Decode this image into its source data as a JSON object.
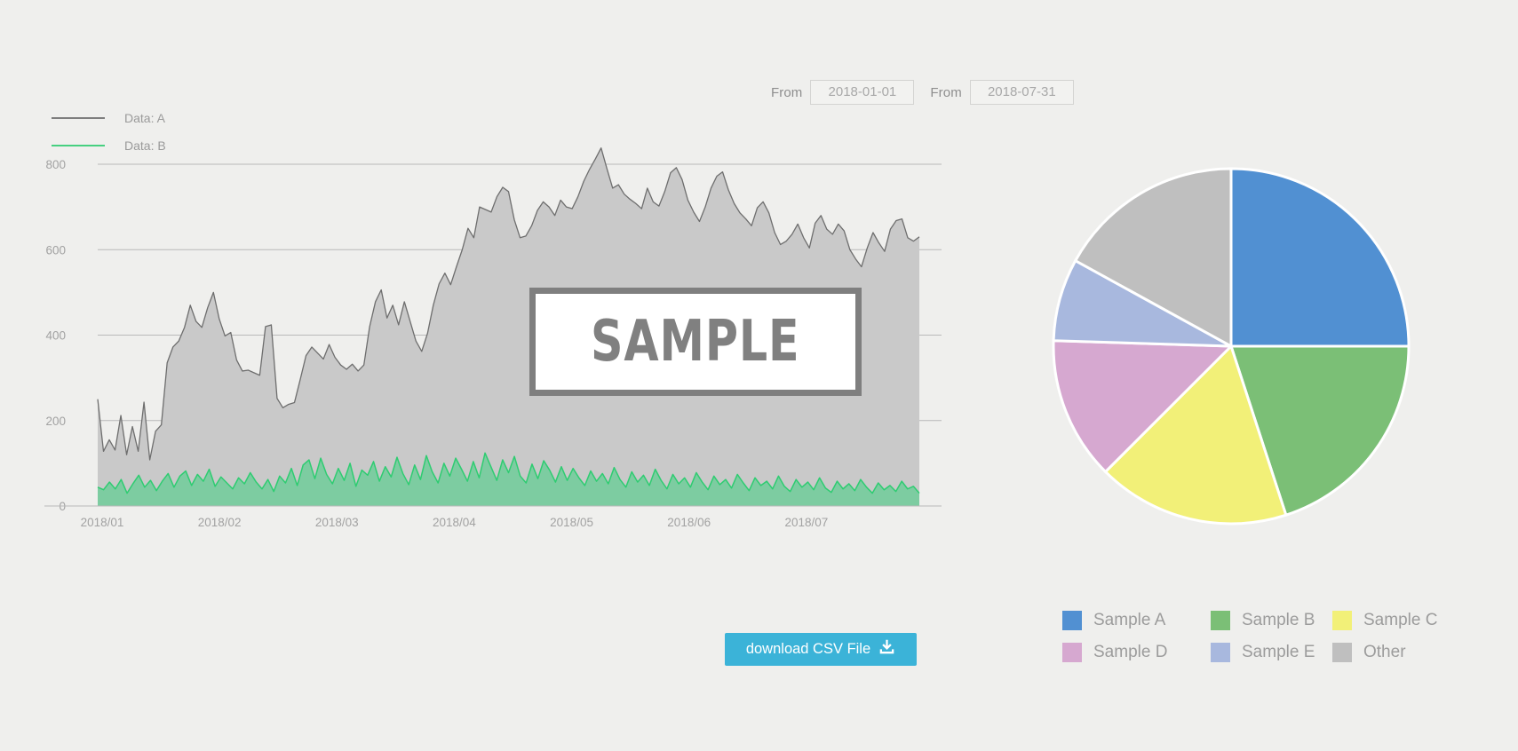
{
  "date_range": {
    "from_label_1": "From",
    "from_value_1": "2018-01-01",
    "from_placeholder_1": "2018-01-01",
    "from_label_2": "From",
    "from_value_2": "2018-07-31",
    "from_placeholder_2": "2018-07-31"
  },
  "watermark": {
    "text": "SAMPLE"
  },
  "download_button": {
    "label": "download CSV File",
    "icon": "download-tray-icon",
    "color": "#3BB3D8"
  },
  "chart_data": [
    {
      "type": "area",
      "title": "",
      "xlabel": "",
      "ylabel": "",
      "ylim": [
        0,
        860
      ],
      "yticks": [
        0,
        200,
        400,
        600,
        800
      ],
      "ytick_labels": [
        "0",
        "200",
        "400",
        "600",
        "800"
      ],
      "xticks": [
        "2018/01",
        "2018/02",
        "2018/03",
        "2018/04",
        "2018/05",
        "2018/06",
        "2018/07"
      ],
      "grid": true,
      "legend_position": "top-left",
      "series": [
        {
          "name": "Data: A",
          "color": "#6E6E6E",
          "fill": "#C9C9C9",
          "values": [
            250,
            128,
            155,
            131,
            212,
            120,
            186,
            128,
            243,
            108,
            175,
            190,
            335,
            372,
            386,
            418,
            470,
            432,
            418,
            464,
            500,
            438,
            398,
            406,
            342,
            316,
            318,
            312,
            306,
            420,
            424,
            252,
            230,
            238,
            242,
            296,
            352,
            372,
            358,
            344,
            378,
            348,
            330,
            320,
            332,
            316,
            330,
            420,
            478,
            506,
            440,
            470,
            424,
            478,
            432,
            386,
            362,
            404,
            470,
            520,
            545,
            518,
            560,
            600,
            650,
            628,
            700,
            694,
            688,
            724,
            746,
            736,
            670,
            628,
            632,
            656,
            692,
            712,
            700,
            680,
            716,
            700,
            696,
            724,
            760,
            788,
            812,
            838,
            790,
            744,
            752,
            730,
            718,
            708,
            696,
            744,
            712,
            702,
            736,
            780,
            792,
            764,
            716,
            688,
            666,
            700,
            744,
            772,
            782,
            740,
            708,
            686,
            672,
            656,
            698,
            712,
            686,
            640,
            612,
            620,
            636,
            660,
            628,
            604,
            662,
            680,
            648,
            636,
            660,
            644,
            600,
            578,
            560,
            604,
            640,
            616,
            596,
            648,
            668,
            672,
            628,
            620,
            630
          ]
        },
        {
          "name": "Data: B",
          "color": "#2ECC71",
          "fill": "#72CC9B",
          "values": [
            44,
            38,
            56,
            40,
            62,
            30,
            52,
            72,
            44,
            60,
            36,
            58,
            76,
            44,
            70,
            82,
            48,
            74,
            58,
            86,
            46,
            68,
            54,
            40,
            66,
            52,
            78,
            56,
            40,
            62,
            34,
            70,
            54,
            88,
            48,
            96,
            108,
            64,
            112,
            74,
            52,
            88,
            60,
            100,
            46,
            84,
            72,
            104,
            58,
            92,
            68,
            114,
            76,
            50,
            96,
            62,
            118,
            80,
            54,
            100,
            70,
            112,
            86,
            58,
            104,
            66,
            124,
            92,
            60,
            108,
            78,
            116,
            70,
            54,
            98,
            64,
            106,
            84,
            56,
            92,
            60,
            88,
            66,
            48,
            82,
            58,
            76,
            52,
            90,
            62,
            44,
            80,
            56,
            72,
            48,
            86,
            60,
            40,
            74,
            52,
            66,
            44,
            78,
            56,
            38,
            70,
            50,
            62,
            42,
            74,
            54,
            36,
            66,
            48,
            58,
            40,
            70,
            46,
            34,
            62,
            44,
            56,
            38,
            66,
            42,
            32,
            58,
            40,
            52,
            36,
            62,
            44,
            30,
            54,
            38,
            48,
            34,
            58,
            40,
            46,
            30
          ]
        }
      ]
    },
    {
      "type": "pie",
      "title": "",
      "legend_position": "bottom",
      "start_angle": 0,
      "direction": "clockwise",
      "labels": [
        "Sample A",
        "Sample B",
        "Sample C",
        "Sample D",
        "Sample E",
        "Other"
      ],
      "values": [
        25,
        20,
        17.5,
        13,
        7.5,
        17
      ],
      "colors": [
        "#5190D2",
        "#7BBF76",
        "#F2F078",
        "#D6A8D0",
        "#A8B8DE",
        "#BFBFBF"
      ]
    }
  ]
}
